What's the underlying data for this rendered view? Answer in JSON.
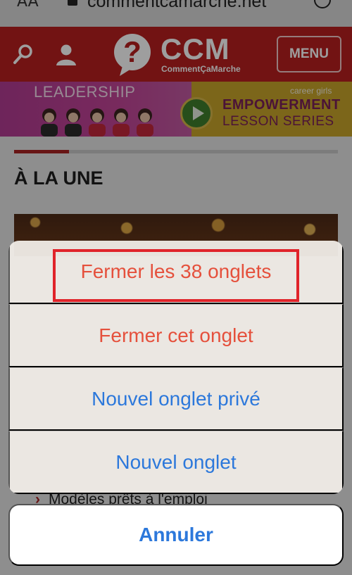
{
  "browser": {
    "text_size_label": "AA",
    "url": "commentcamarche.net"
  },
  "site": {
    "logo_text": "CCM",
    "logo_subtitle": "CommentÇaMarche",
    "menu_label": "MENU",
    "icons": [
      "search-icon",
      "user-icon",
      "question-bubble-logo"
    ]
  },
  "banner": {
    "left_title": "LEADERSHIP",
    "brand": "career girls",
    "line1": "EMPOWERMENT",
    "line2": "LESSON SERIES"
  },
  "content": {
    "section_title": "À LA UNE",
    "progress_fraction": 0.17,
    "peek_item": "Modèles prêts à l'emploi"
  },
  "action_sheet": {
    "actions": [
      {
        "label": "Fermer les 38 onglets",
        "style": "destructive",
        "highlighted": true
      },
      {
        "label": "Fermer cet onglet",
        "style": "destructive"
      },
      {
        "label": "Nouvel onglet privé",
        "style": "default"
      },
      {
        "label": "Nouvel onglet",
        "style": "default"
      }
    ],
    "cancel_label": "Annuler"
  },
  "colors": {
    "destructive": "#e5503c",
    "default_action": "#2c78db",
    "site_red": "#b8201f",
    "highlight_box": "#e0232a"
  }
}
